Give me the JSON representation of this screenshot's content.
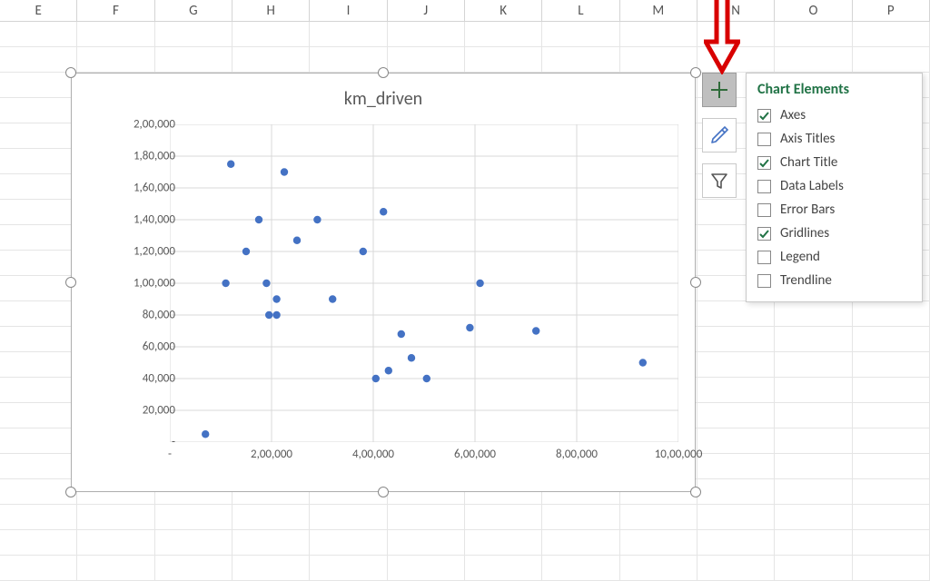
{
  "columns": [
    "E",
    "F",
    "G",
    "H",
    "I",
    "J",
    "K",
    "L",
    "M",
    "N",
    "O",
    "P"
  ],
  "chart": {
    "title": "km_driven",
    "x_ticks": [
      "-",
      "2,00,000",
      "4,00,000",
      "6,00,000",
      "8,00,000",
      "10,00,000"
    ],
    "y_ticks": [
      "-",
      "20,000",
      "40,000",
      "60,000",
      "80,000",
      "1,00,000",
      "1,20,000",
      "1,40,000",
      "1,60,000",
      "1,80,000",
      "2,00,000"
    ]
  },
  "side_buttons": {
    "plus_tooltip": "Chart Elements",
    "brush_tooltip": "Chart Styles",
    "funnel_tooltip": "Chart Filters"
  },
  "flyout": {
    "title": "Chart Elements",
    "items": [
      {
        "label": "Axes",
        "checked": true
      },
      {
        "label": "Axis Titles",
        "checked": false
      },
      {
        "label": "Chart Title",
        "checked": true
      },
      {
        "label": "Data Labels",
        "checked": false
      },
      {
        "label": "Error Bars",
        "checked": false
      },
      {
        "label": "Gridlines",
        "checked": true
      },
      {
        "label": "Legend",
        "checked": false
      },
      {
        "label": "Trendline",
        "checked": false
      }
    ]
  },
  "chart_data": {
    "type": "scatter",
    "title": "km_driven",
    "xlabel": "",
    "ylabel": "",
    "xlim": [
      0,
      1000000
    ],
    "ylim": [
      0,
      200000
    ],
    "x_tick_values": [
      0,
      200000,
      400000,
      600000,
      800000,
      1000000
    ],
    "y_tick_values": [
      0,
      20000,
      40000,
      60000,
      80000,
      100000,
      120000,
      140000,
      160000,
      180000,
      200000
    ],
    "grid": true,
    "legend": false,
    "series": [
      {
        "name": "km_driven",
        "points": [
          {
            "x": 70000,
            "y": 5000
          },
          {
            "x": 110000,
            "y": 100000
          },
          {
            "x": 120000,
            "y": 175000
          },
          {
            "x": 150000,
            "y": 120000
          },
          {
            "x": 175000,
            "y": 140000
          },
          {
            "x": 190000,
            "y": 100000
          },
          {
            "x": 195000,
            "y": 80000
          },
          {
            "x": 210000,
            "y": 80000
          },
          {
            "x": 210000,
            "y": 90000
          },
          {
            "x": 225000,
            "y": 170000
          },
          {
            "x": 250000,
            "y": 127000
          },
          {
            "x": 290000,
            "y": 140000
          },
          {
            "x": 320000,
            "y": 90000
          },
          {
            "x": 380000,
            "y": 120000
          },
          {
            "x": 405000,
            "y": 40000
          },
          {
            "x": 420000,
            "y": 145000
          },
          {
            "x": 430000,
            "y": 45000
          },
          {
            "x": 455000,
            "y": 68000
          },
          {
            "x": 475000,
            "y": 53000
          },
          {
            "x": 505000,
            "y": 40000
          },
          {
            "x": 590000,
            "y": 72000
          },
          {
            "x": 610000,
            "y": 100000
          },
          {
            "x": 720000,
            "y": 70000
          },
          {
            "x": 930000,
            "y": 50000
          }
        ]
      }
    ]
  }
}
